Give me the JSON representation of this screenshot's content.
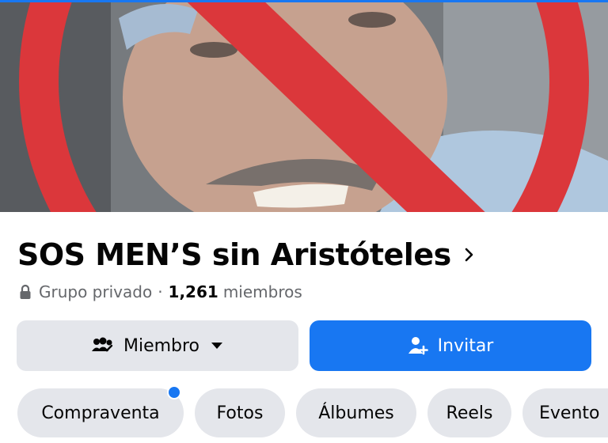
{
  "cover": {
    "image_alt": "Group cover photo"
  },
  "group": {
    "name": "SOS MEN’S sin Aristóteles",
    "privacy": "Grupo privado",
    "separator": "·",
    "member_count": "1,261",
    "members_label": "miembros"
  },
  "actions": {
    "member_label": "Miembro",
    "invite_label": "Invitar"
  },
  "tabs": [
    {
      "label": "Compraventa",
      "has_notification": true
    },
    {
      "label": "Fotos"
    },
    {
      "label": "Álbumes"
    },
    {
      "label": "Reels"
    },
    {
      "label": "Evento"
    }
  ],
  "colors": {
    "accent": "#1877f2",
    "chip_bg": "#e4e6eb",
    "secondary_text": "#65676b",
    "prohibition_red": "#d8262b"
  },
  "icons": {
    "lock": "lock-icon",
    "members": "group-members-icon",
    "caret": "caret-down-icon",
    "invite": "add-person-icon",
    "chevron": "chevron-right-icon"
  }
}
